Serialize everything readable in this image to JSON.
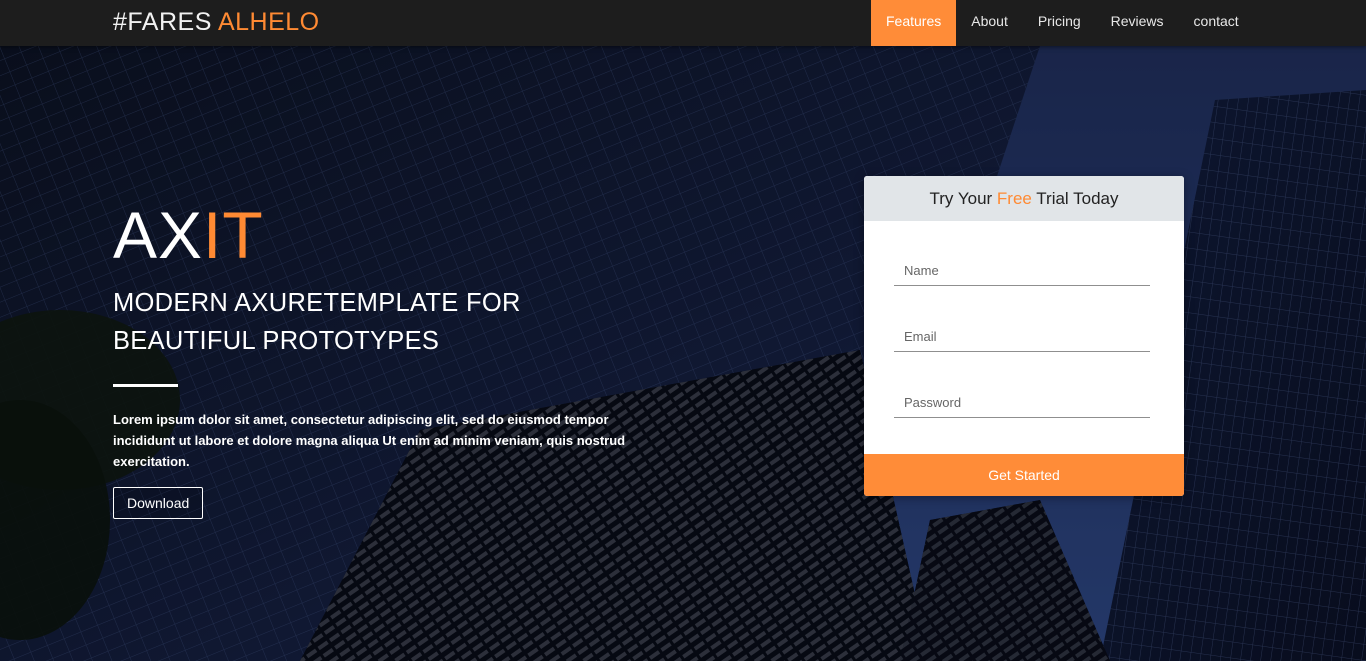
{
  "navbar": {
    "brand_prefix": "#FARES",
    "brand_accent": "ALHELO",
    "items": [
      {
        "label": "Features",
        "active": true
      },
      {
        "label": "About",
        "active": false
      },
      {
        "label": "Pricing",
        "active": false
      },
      {
        "label": "Reviews",
        "active": false
      },
      {
        "label": "contact",
        "active": false
      }
    ]
  },
  "hero": {
    "title_prefix": "AX",
    "title_accent": "IT",
    "subtitle": "MODERN AXURETEMPLATE FOR BEAUTIFUL PROTOTYPES",
    "description": "Lorem ipsum dolor sit amet, consectetur adipiscing elit, sed do eiusmod tempor incididunt ut labore et dolore magna aliqua Ut enim ad minim veniam, quis nostrud exercitation.",
    "button_label": "Download"
  },
  "signup": {
    "heading_prefix": "Try Your ",
    "heading_accent": "Free",
    "heading_suffix": " Trial Today",
    "name_placeholder": "Name",
    "email_placeholder": "Email",
    "password_placeholder": "Password",
    "button_label": "Get Started"
  },
  "colors": {
    "accent": "#ff8c38",
    "navbar_bg": "#1d1d1d",
    "card_head_bg": "#e1e5e8"
  }
}
